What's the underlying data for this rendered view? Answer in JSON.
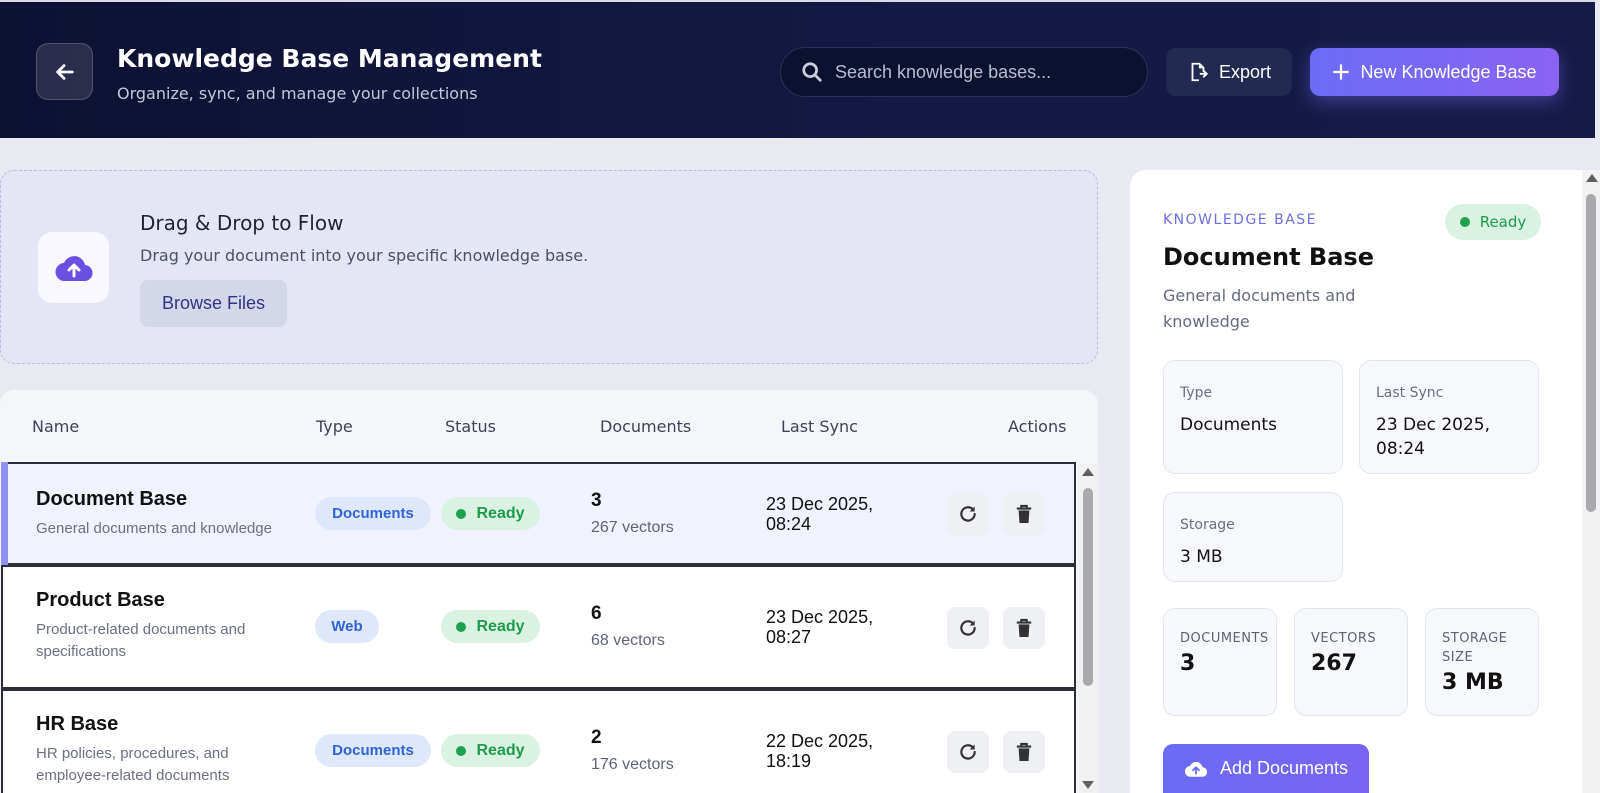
{
  "header": {
    "title": "Knowledge Base Management",
    "subtitle": "Organize, sync, and manage your collections",
    "search_placeholder": "Search knowledge bases...",
    "export_label": "Export",
    "new_label": "New Knowledge Base"
  },
  "dropzone": {
    "title": "Drag & Drop to Flow",
    "description": "Drag your document into your specific knowledge base.",
    "browse_label": "Browse Files"
  },
  "table": {
    "headers": [
      "Name",
      "Type",
      "Status",
      "Documents",
      "Last Sync",
      "Actions"
    ],
    "rows": [
      {
        "name": "Document Base",
        "description": "General documents and knowledge",
        "type": "Documents",
        "status": "Ready",
        "documents": "3",
        "vectors": "267 vectors",
        "last_sync": "23 Dec 2025, 08:24",
        "selected": true
      },
      {
        "name": "Product Base",
        "description": "Product-related documents and specifications",
        "type": "Web",
        "status": "Ready",
        "documents": "6",
        "vectors": "68 vectors",
        "last_sync": "23 Dec 2025, 08:27",
        "selected": false
      },
      {
        "name": "HR Base",
        "description": "HR policies, procedures, and employee-related documents",
        "type": "Documents",
        "status": "Ready",
        "documents": "2",
        "vectors": "176 vectors",
        "last_sync": "22 Dec 2025, 18:19",
        "selected": false
      }
    ]
  },
  "detail": {
    "kicker": "KNOWLEDGE BASE",
    "status": "Ready",
    "title": "Document Base",
    "description": "General documents and knowledge",
    "type_label": "Type",
    "type_value": "Documents",
    "sync_label": "Last Sync",
    "sync_value": "23 Dec 2025, 08:24",
    "storage_label": "Storage",
    "storage_value": "3 MB",
    "stats": [
      {
        "label": "DOCUMENTS",
        "value": "3"
      },
      {
        "label": "VECTORS",
        "value": "267"
      },
      {
        "label": "STORAGE SIZE",
        "value": "3 MB"
      }
    ],
    "add_label": "Add Documents"
  },
  "colors": {
    "accent": "#6a6cf6",
    "header_bg": "#0d1233",
    "ready_green": "#1f9a4c",
    "type_blue": "#2f63d6"
  },
  "icons": [
    "arrow-left-icon",
    "search-icon",
    "export-file-icon",
    "plus-icon",
    "cloud-upload-icon",
    "refresh-icon",
    "trash-icon"
  ]
}
